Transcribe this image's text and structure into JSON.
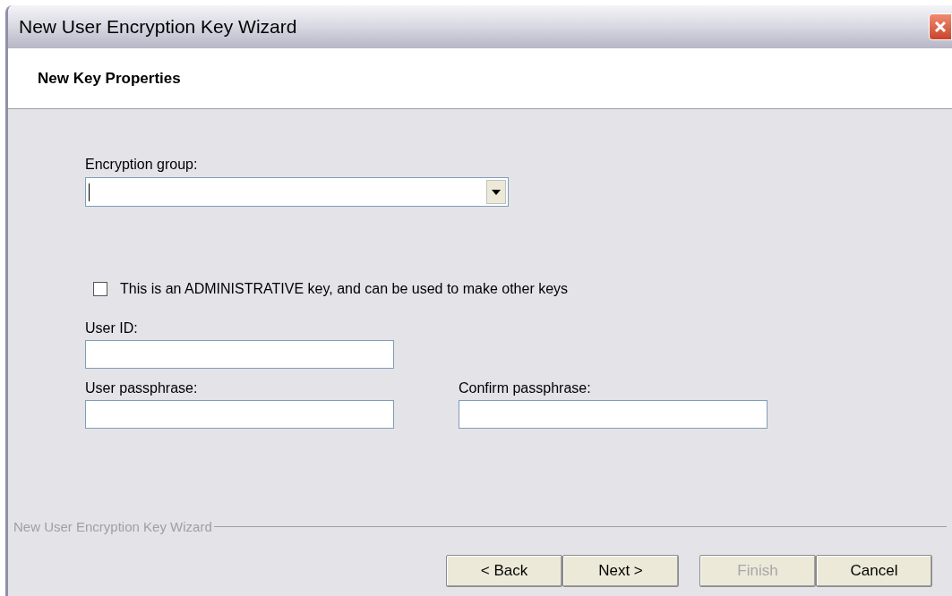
{
  "window": {
    "title": "New User Encryption Key Wizard"
  },
  "header": {
    "title": "New Key Properties"
  },
  "encryption_group": {
    "label": "Encryption group:"
  },
  "admin_checkbox": {
    "label": "This is an ADMINISTRATIVE key, and can be used to make other keys",
    "checked": false
  },
  "user_id": {
    "label": "User ID:"
  },
  "user_passphrase": {
    "label": "User passphrase:"
  },
  "confirm_passphrase": {
    "label": "Confirm passphrase:"
  },
  "group_label": "New User Encryption Key Wizard",
  "buttons": [
    {
      "label": "< Back",
      "disabled": false
    },
    {
      "label": "Next >",
      "disabled": false
    },
    {
      "label": "Finish",
      "disabled": true
    },
    {
      "label": "Cancel",
      "disabled": false
    }
  ]
}
